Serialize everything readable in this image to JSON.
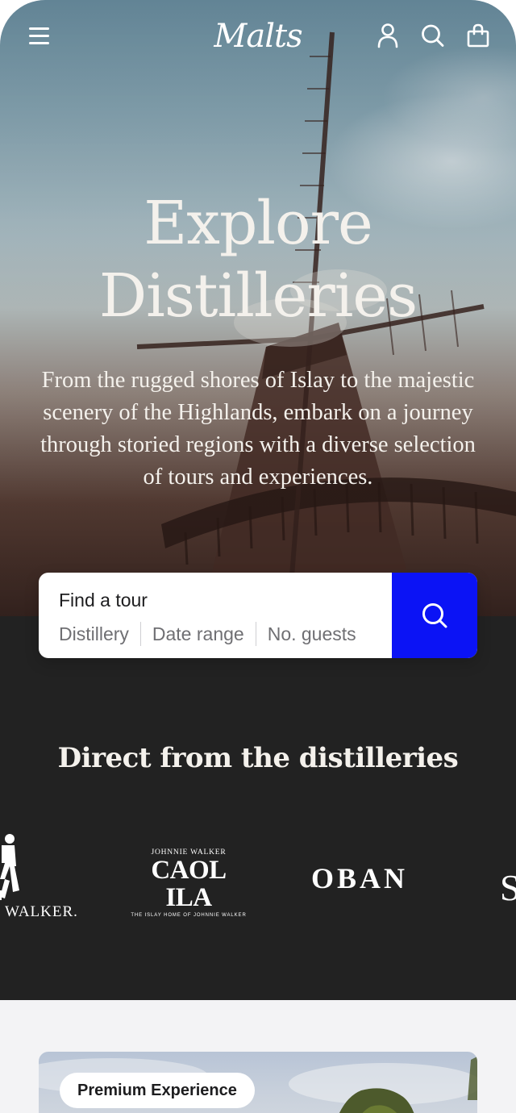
{
  "nav": {
    "logo": "Malts",
    "menu_icon": "hamburger-menu-icon",
    "account_icon": "user-icon",
    "search_icon": "search-icon",
    "bag_icon": "shopping-bag-icon"
  },
  "hero": {
    "title_line1": "Explore",
    "title_line2": "Distilleries",
    "subtitle": "From the rugged shores of Islay to the majestic scenery of the Highlands, embark on a journey through storied regions with a diverse selection of tours and experiences."
  },
  "search": {
    "label": "Find a tour",
    "fields": [
      "Distillery",
      "Date range",
      "No. guests"
    ],
    "button_icon": "search-icon",
    "accent_color": "#0b13f5"
  },
  "brands": {
    "title": "Direct from the distilleries",
    "logos": {
      "johnnie_walker": {
        "word": "WALKER."
      },
      "caol_ila": {
        "top": "JOHNNIE WALKER",
        "main": "CAOL ILA",
        "bottom": "THE ISLAY HOME OF JOHNNIE WALKER"
      },
      "oban": "OBAN",
      "partial": "S"
    }
  },
  "featured": {
    "badge": "Premium Experience"
  },
  "colors": {
    "dark_section": "#222222",
    "light_section": "#f3f3f5",
    "hero_text": "#f4f1ec"
  }
}
